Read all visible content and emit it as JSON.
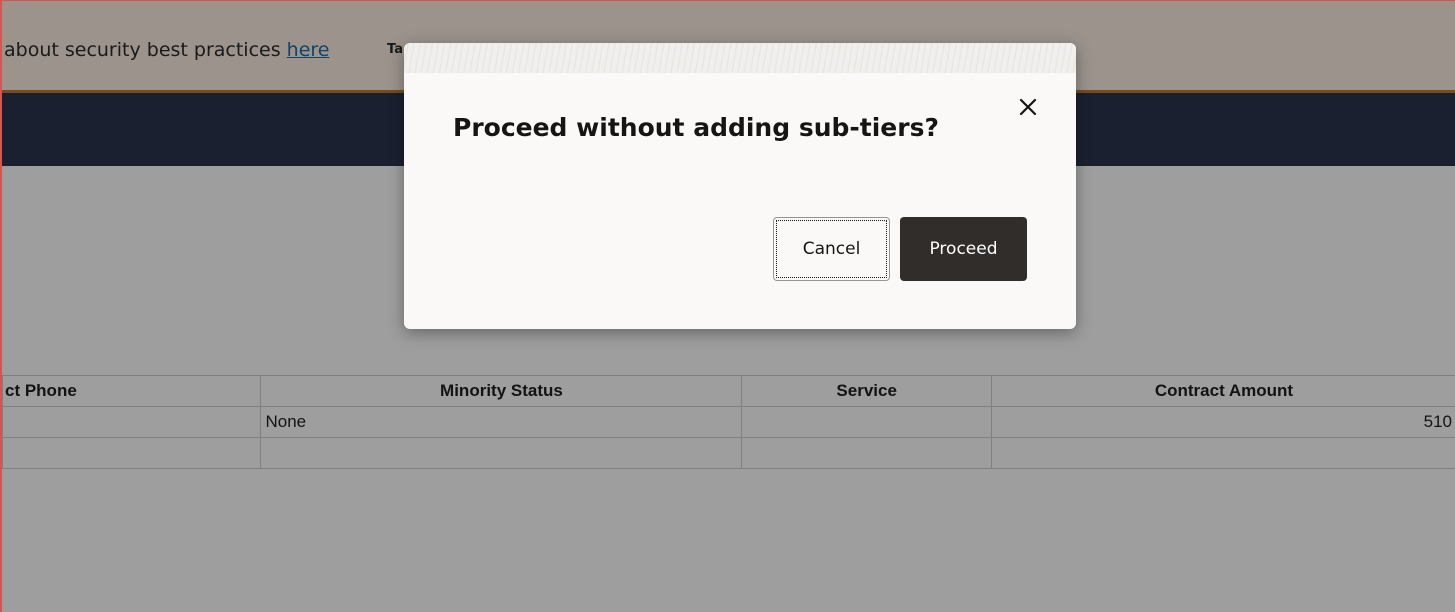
{
  "banner": {
    "message_prefix": "about security best practices ",
    "link_text": "here",
    "trailing_text": "Ta"
  },
  "table": {
    "columns": [
      {
        "label": "ct Phone"
      },
      {
        "label": "Minority Status"
      },
      {
        "label": "Service"
      },
      {
        "label": "Contract Amount"
      }
    ],
    "rows": [
      [
        "",
        "None",
        "",
        "510"
      ],
      [
        "",
        "",
        "",
        ""
      ]
    ]
  },
  "dialog": {
    "title": "Proceed without adding sub-tiers?",
    "close_icon": "close-icon",
    "cancel_label": "Cancel",
    "proceed_label": "Proceed"
  },
  "colors": {
    "banner_bg": "#fbeee3",
    "banner_border": "#c77a2a",
    "nav_band": "#2b354d",
    "primary_button": "#312d2a",
    "link": "#1d6fa5"
  }
}
